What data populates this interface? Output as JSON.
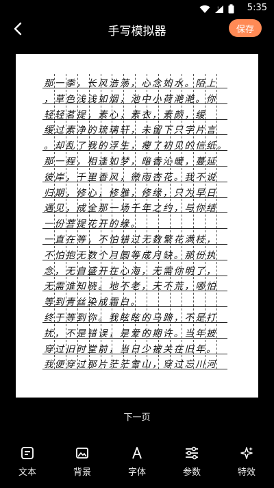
{
  "status": {
    "time": "5:35",
    "icons": [
      "wifi-icon",
      "signal-icon",
      "battery-icon"
    ]
  },
  "header": {
    "title": "手写模拟器",
    "back_icon": "chevron-left-icon",
    "save_label": "保存",
    "save_color": "#ff8a55"
  },
  "paper": {
    "lines": [
      "那一季，长风浩荡，心念如水。陌上",
      "，草色浅浅如烟，池中小荷滟滟。你",
      "轻轻茗提，素心，素衣，素颜，缓",
      "缓过素净的琉璃轩，未留下只字片言",
      "。却乱了我的浮生，瘦了初见的信纸。",
      "那一程，相逢如梦，暗香沁暖，蔓延",
      "彼岸，千里香风，微雨杏花。我不说",
      "归期，修心，修雅，修缘，只为早日",
      "遇见，成全那一场千年之约，与你结",
      "一份菩提花开的缘。",
      "一直在等，不怕错过无数繁花满枝，",
      "不怕抱无数个月圆等成月缺。那份执",
      "念，无自盛开在心海，无需你明了，",
      "无需谁知晓。地不老，天不荒，哪怕",
      "等到青丝染成霜白。",
      "终于等到你。我眩眩的马蹄，不是打",
      "扰，不是错误，是爱的期许。当年披",
      "穿过旧时堂前，当日少被关在旧年。",
      "我便穿过那片茫茫雪山，穿过忘川河"
    ]
  },
  "footer": {
    "next_page": "下一页"
  },
  "toolbar": {
    "items": [
      {
        "label": "文本",
        "icon": "text-icon"
      },
      {
        "label": "背景",
        "icon": "image-icon"
      },
      {
        "label": "字体",
        "icon": "font-icon"
      },
      {
        "label": "参数",
        "icon": "sliders-icon"
      },
      {
        "label": "特效",
        "icon": "sparkle-icon"
      }
    ]
  }
}
